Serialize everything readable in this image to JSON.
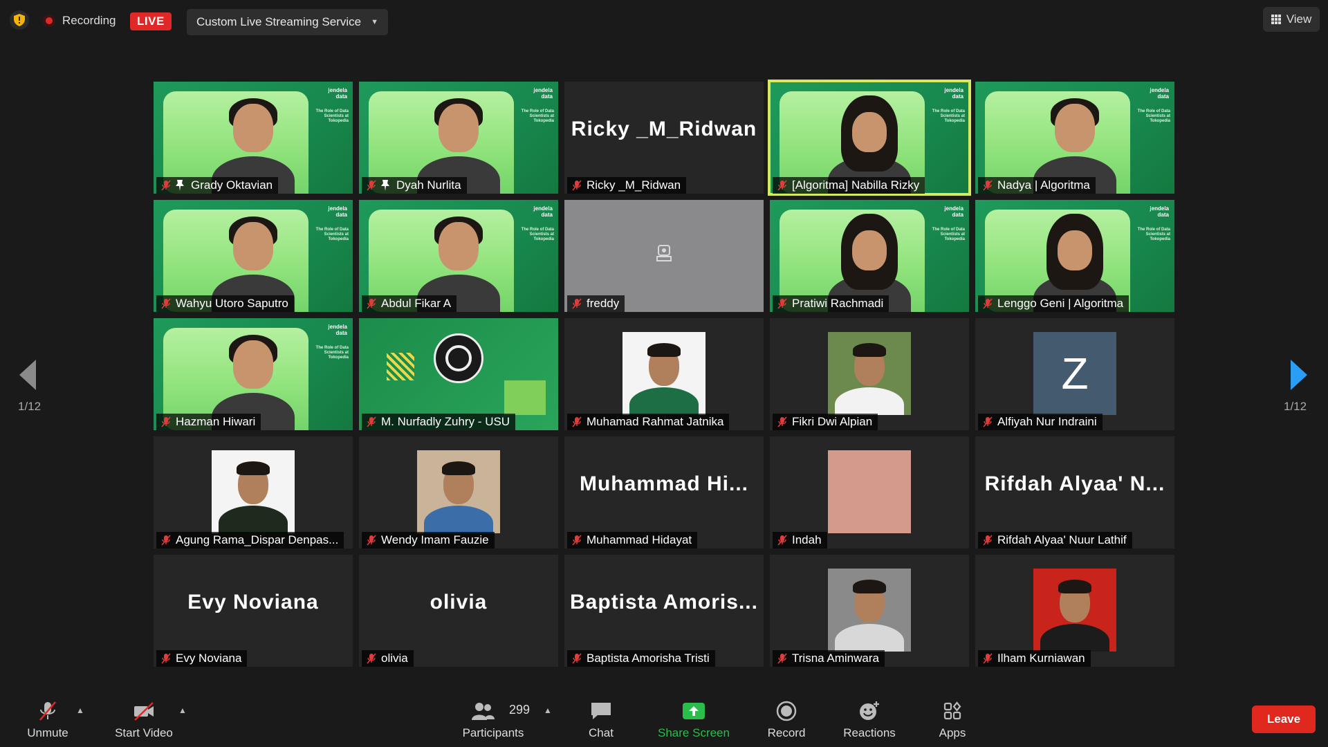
{
  "topbar": {
    "recording_label": "Recording",
    "live_label": "LIVE",
    "stream_service": "Custom Live Streaming Service",
    "view_label": "View"
  },
  "pagination": {
    "left": "1/12",
    "right": "1/12"
  },
  "tiles": [
    {
      "name": "Grady Oktavian",
      "pinned": true
    },
    {
      "name": "Dyah Nurlita",
      "pinned": true
    },
    {
      "name": "Ricky _M_Ridwan",
      "big": "Ricky _M_Ridwan"
    },
    {
      "name": "[Algoritma] Nabilla Rizky",
      "active": true
    },
    {
      "name": "Nadya | Algoritma"
    },
    {
      "name": "Wahyu Utoro Saputro"
    },
    {
      "name": "Abdul Fikar A"
    },
    {
      "name": "freddy"
    },
    {
      "name": "Pratiwi Rachmadi"
    },
    {
      "name": "Lenggo Geni | Algoritma"
    },
    {
      "name": "Hazman Hiwari"
    },
    {
      "name": "M. Nurfadly Zuhry - USU"
    },
    {
      "name": "Muhamad Rahmat Jatnika"
    },
    {
      "name": "Fikri Dwi Alpian"
    },
    {
      "name": "Alfiyah Nur Indraini",
      "initial": "Z"
    },
    {
      "name": "Agung Rama_Dispar Denpas..."
    },
    {
      "name": "Wendy Imam Fauzie"
    },
    {
      "name": "Muhammad Hidayat",
      "big": "Muhammad Hi..."
    },
    {
      "name": "Indah"
    },
    {
      "name": "Rifdah Alyaa' Nuur Lathif",
      "big": "Rifdah Alyaa' N..."
    },
    {
      "name": "Evy Noviana",
      "big": "Evy Noviana"
    },
    {
      "name": "olivia",
      "big": "olivia"
    },
    {
      "name": "Baptista Amorisha Tristi",
      "big": "Baptista Amoris..."
    },
    {
      "name": "Trisna Aminwara"
    },
    {
      "name": "Ilham Kurniawan"
    }
  ],
  "brand": {
    "line1": "jendela data",
    "line2": "The Role of Data Scientists at Tokopedia"
  },
  "toolbar": {
    "unmute": "Unmute",
    "start_video": "Start Video",
    "participants_count": "299",
    "participants": "Participants",
    "chat": "Chat",
    "share_screen": "Share Screen",
    "record": "Record",
    "reactions": "Reactions",
    "apps": "Apps",
    "leave": "Leave"
  },
  "colors": {
    "active_speaker": "#d7ea5e",
    "live": "#e02828",
    "share": "#2bbd4a",
    "leave": "#e0281e",
    "arrow_next": "#2a9df4"
  }
}
